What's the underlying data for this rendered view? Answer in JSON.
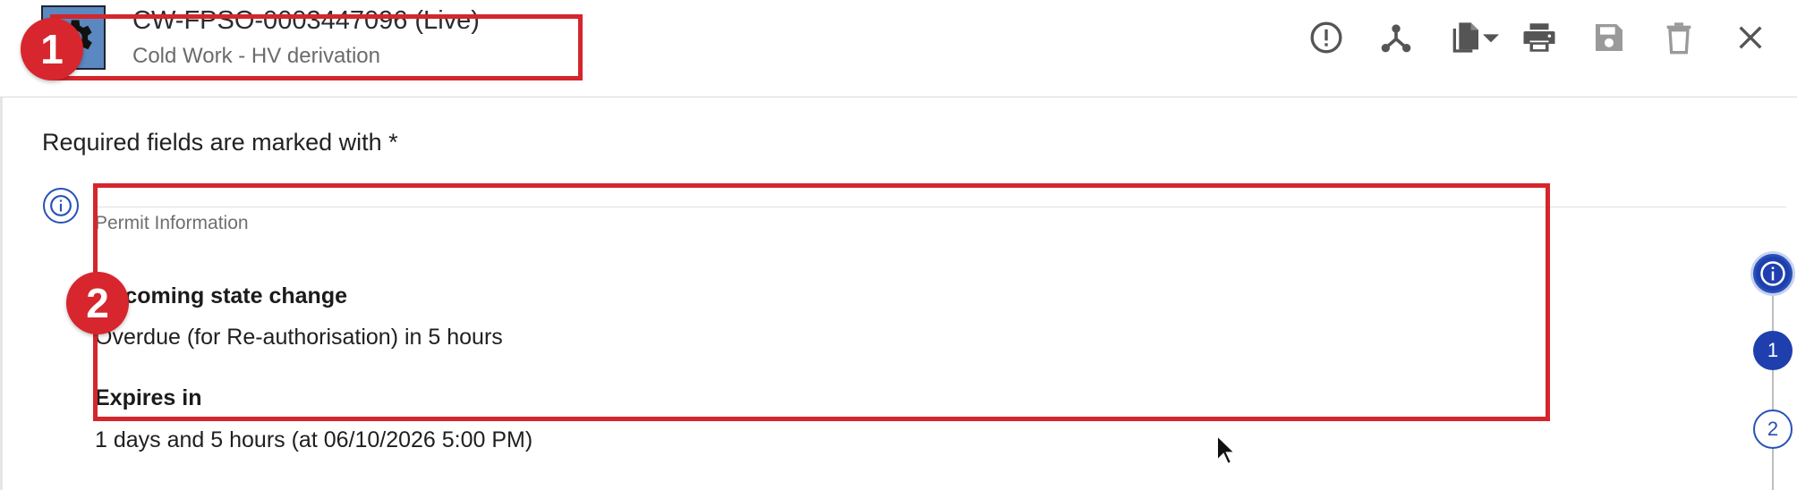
{
  "header": {
    "title": "CW-FPSO-0003447096 (Live)",
    "subtitle": "Cold Work - HV derivation",
    "app_icon": "gear-icon",
    "toolbar_icons": [
      "alert-circle-icon",
      "workflow-icon",
      "copy-document-icon",
      "dropdown-caret-icon",
      "print-icon",
      "save-icon",
      "delete-icon",
      "close-icon"
    ]
  },
  "form": {
    "required_note": "Required fields are marked with *",
    "section_title": "Permit Information",
    "fields": [
      {
        "label": "Upcoming state change",
        "value": "Overdue (for Re-authorisation) in 5 hours"
      },
      {
        "label": "Expires in",
        "value": "1 days and 5 hours (at 06/10/2026 5:00 PM)"
      }
    ]
  },
  "stepper": {
    "steps": [
      "1",
      "2"
    ],
    "info_icon": "info-icon"
  },
  "annotations": [
    "1",
    "2"
  ],
  "colors": {
    "accent": "#1f3fae",
    "annotation_red": "#d4262c",
    "app_icon_bg": "#5b88c0"
  }
}
